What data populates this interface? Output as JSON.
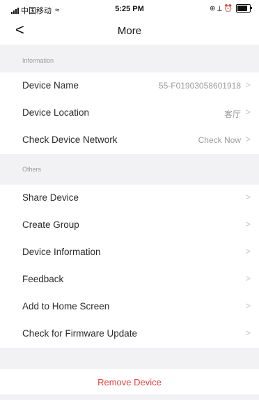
{
  "status_bar": {
    "carrier": "中国移动",
    "wifi_icon": "wifi-icon",
    "time": "5:25 PM",
    "status_icons": "⊕ ⟂ ⏰"
  },
  "nav": {
    "back_glyph": "<",
    "title": "More"
  },
  "sections": {
    "information": {
      "header": "Information",
      "rows": [
        {
          "label": "Device Name",
          "value": "55-F01903058601918"
        },
        {
          "label": "Device Location",
          "value": "客厅"
        },
        {
          "label": "Check Device Network",
          "value": "Check Now"
        }
      ]
    },
    "others": {
      "header": "Others",
      "rows": [
        {
          "label": "Share Device"
        },
        {
          "label": "Create Group"
        },
        {
          "label": "Device Information"
        },
        {
          "label": "Feedback"
        },
        {
          "label": "Add to Home Screen"
        },
        {
          "label": "Check for Firmware Update"
        }
      ]
    }
  },
  "chevron_glyph": ">",
  "remove_button": {
    "label": "Remove Device",
    "color": "#e64340"
  },
  "colors": {
    "background": "#f2f2f5",
    "row_bg": "#ffffff",
    "secondary_text": "#9b9b9b"
  }
}
